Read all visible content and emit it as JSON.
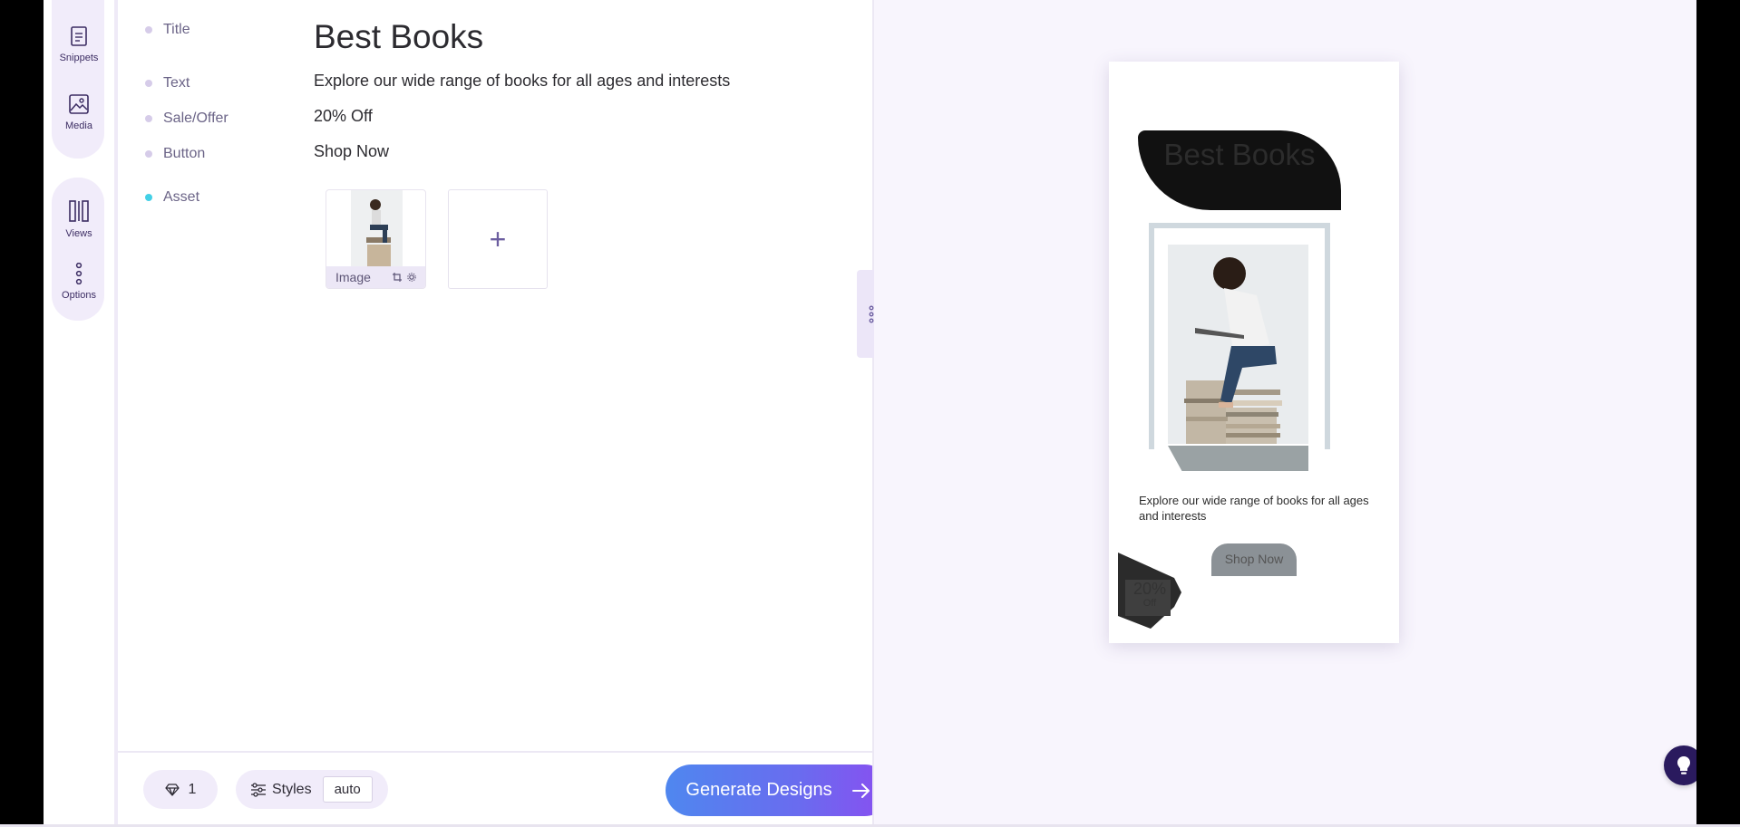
{
  "sidebar": {
    "items": [
      {
        "label": "Snippets",
        "icon": "document-icon"
      },
      {
        "label": "Media",
        "icon": "image-icon"
      },
      {
        "label": "Views",
        "icon": "columns-icon"
      },
      {
        "label": "Options",
        "icon": "vertical-dots-icon"
      }
    ]
  },
  "fields": {
    "title_label": "Title",
    "title_value": "Best Books",
    "text_label": "Text",
    "text_value": "Explore our wide range of books for all ages and interests",
    "sale_label": "Sale/Offer",
    "sale_value": "20% Off",
    "button_label": "Button",
    "button_value": "Shop Now",
    "asset_label": "Asset"
  },
  "asset": {
    "card_label": "Image",
    "add_symbol": "+"
  },
  "footer": {
    "gem_count": "1",
    "styles_label": "Styles",
    "styles_value": "auto",
    "generate_label": "Generate Designs"
  },
  "preview": {
    "title": "Best Books",
    "text": "Explore our wide range of books for all ages and interests",
    "button": "Shop Now",
    "badge_main": "20%",
    "badge_sub": "Off"
  },
  "colors": {
    "accent": "#6a5acd",
    "gradient_start": "#4f87ef",
    "gradient_end": "#8a4ef0",
    "asset_dot": "#43d0e6"
  }
}
